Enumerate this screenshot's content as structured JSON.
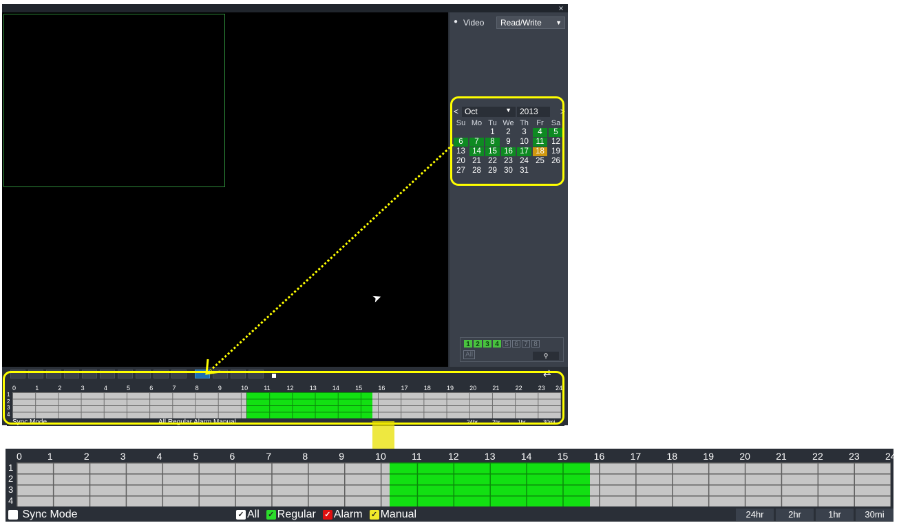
{
  "window": {
    "close_icon": "×"
  },
  "panel": {
    "mode_label": "Video",
    "mode_value": "Read/Write"
  },
  "calendar": {
    "prev": "<",
    "next": ">",
    "month": "Oct",
    "year": "2013",
    "weekdays": [
      "Su",
      "Mo",
      "Tu",
      "We",
      "Th",
      "Fr",
      "Sa"
    ],
    "recorded_days": [
      4,
      5,
      6,
      7,
      8,
      11,
      14,
      15,
      16,
      17
    ],
    "selected_day": 18
  },
  "channels": {
    "items": [
      "1",
      "2",
      "3",
      "4",
      "5",
      "6",
      "7",
      "8"
    ],
    "active": [
      1,
      2,
      3,
      4
    ],
    "all_label": "All"
  },
  "timeline": {
    "hours": [
      "0",
      "1",
      "2",
      "3",
      "4",
      "5",
      "6",
      "7",
      "8",
      "9",
      "10",
      "11",
      "12",
      "13",
      "14",
      "15",
      "16",
      "17",
      "18",
      "19",
      "20",
      "21",
      "22",
      "23",
      "24"
    ],
    "channels": [
      "1",
      "2",
      "3",
      "4"
    ],
    "sync_mode": "Sync Mode",
    "legend": {
      "all": "All",
      "regular": "Regular",
      "alarm": "Alarm",
      "manual": "Manual"
    },
    "zoom_buttons": [
      "24hr",
      "2hr",
      "1hr",
      "30mi"
    ],
    "recording_range": [
      10.25,
      15.75
    ]
  },
  "colors": {
    "recorded": "#12e012",
    "highlight": "#ffff00",
    "selected_day": "#d09810"
  }
}
